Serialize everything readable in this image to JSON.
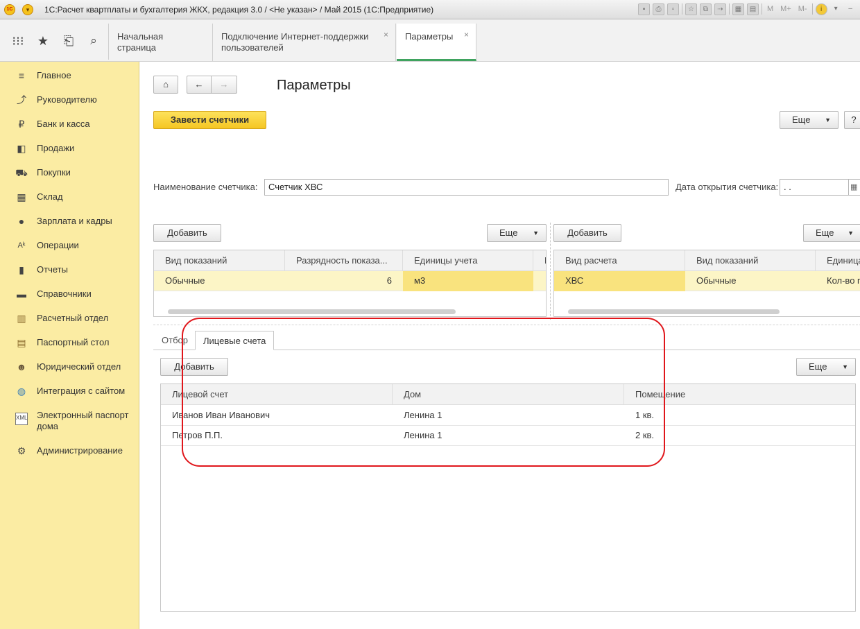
{
  "window": {
    "title": "1С:Расчет квартплаты и бухгалтерия ЖКХ, редакция 3.0 / <Не указан> / Май 2015  (1С:Предприятие)",
    "logo_text": "1С",
    "toolbar_text": [
      "M",
      "M+",
      "M-"
    ]
  },
  "section_bar": {
    "tabs": [
      {
        "label": "Начальная страница"
      },
      {
        "label": "Подключение Интернет-поддержки пользователей",
        "close": "×"
      },
      {
        "label": "Параметры",
        "close": "×"
      }
    ]
  },
  "sidebar": {
    "items": [
      {
        "label": "Главное",
        "icon": "menu-icon"
      },
      {
        "label": "Руководителю",
        "icon": "chart-trend-icon"
      },
      {
        "label": "Банк и касса",
        "icon": "ruble-icon"
      },
      {
        "label": "Продажи",
        "icon": "shopping-bag-icon"
      },
      {
        "label": "Покупки",
        "icon": "cart-icon"
      },
      {
        "label": "Склад",
        "icon": "warehouse-icon"
      },
      {
        "label": "Зарплата и кадры",
        "icon": "person-icon"
      },
      {
        "label": "Операции",
        "icon": "operations-icon"
      },
      {
        "label": "Отчеты",
        "icon": "bar-chart-icon"
      },
      {
        "label": "Справочники",
        "icon": "book-icon"
      },
      {
        "label": "Расчетный отдел",
        "icon": "ledger-icon"
      },
      {
        "label": "Паспортный стол",
        "icon": "passport-icon"
      },
      {
        "label": "Юридический отдел",
        "icon": "lawyer-icon"
      },
      {
        "label": "Интеграция с сайтом",
        "icon": "globe-icon"
      },
      {
        "label": "Электронный паспорт дома",
        "icon": "xml-doc-icon"
      },
      {
        "label": "Администрирование",
        "icon": "gear-icon"
      }
    ]
  },
  "form": {
    "title": "Параметры",
    "create_meters_button": "Завести счетчики",
    "more_button": "Еще",
    "help_button": "?",
    "meter_name_label": "Наименование счетчика:",
    "meter_name_value": "Счетчик ХВС",
    "open_date_label": "Дата открытия счетчика:",
    "open_date_value": " .  . "
  },
  "left_table": {
    "add_button": "Добавить",
    "more_button": "Еще",
    "columns": [
      "Вид показаний",
      "Разрядность показа...",
      "Единицы учета",
      "Н"
    ],
    "rows": [
      [
        "Обычные",
        "6",
        "м3"
      ]
    ]
  },
  "right_table": {
    "add_button": "Добавить",
    "more_button": "Еще",
    "columns": [
      "Вид расчета",
      "Вид показаний",
      "Единица"
    ],
    "rows": [
      [
        "ХВС",
        "Обычные",
        "Кол-во п"
      ]
    ]
  },
  "bottom_tabs": {
    "tabs": [
      "Отбор",
      "Лицевые счета"
    ],
    "active": "Лицевые счета"
  },
  "accounts_table": {
    "add_button": "Добавить",
    "more_button": "Еще",
    "columns": [
      "Лицевой счет",
      "Дом",
      "Помещение"
    ],
    "rows": [
      [
        "Иванов Иван Иванович",
        "Ленина 1",
        "1 кв."
      ],
      [
        "Петров П.П.",
        "Ленина 1",
        "2 кв."
      ]
    ]
  },
  "colors": {
    "sidebar_bg": "#fbeca3",
    "primary_button": "#f5c623",
    "active_tab_underline": "#3fa35f",
    "selected_row": "#fcf5c6",
    "annotation": "#e0161b"
  }
}
